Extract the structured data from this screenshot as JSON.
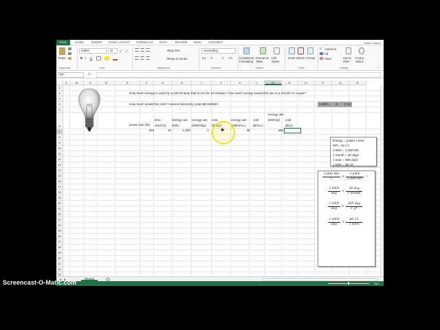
{
  "ribbon": {
    "tabs": [
      "FILE",
      "HOME",
      "INSERT",
      "PAGE LAYOUT",
      "FORMULAS",
      "DATA",
      "REVIEW",
      "VIEW",
      "ACROBAT"
    ],
    "user": "Daniel Kasper",
    "paste_label": "Paste",
    "font_name": "Calibri",
    "font_size": "11",
    "bold": "B",
    "italic": "I",
    "underline": "U",
    "wrap_text": "Wrap Text",
    "merge_center": "Merge & Center",
    "number_format": "Accounting",
    "conditional_formatting": "Conditional Formatting",
    "format_as_table": "Format as Table",
    "cell_styles": "Cell Styles",
    "insert": "Insert",
    "delete": "Delete",
    "format": "Format",
    "autosum": "AutoSum",
    "fill": "Fill",
    "clear": "Clear",
    "sort_filter": "Sort & Filter",
    "find_select": "Find & Select",
    "groups": {
      "clipboard": "Clipboard",
      "font": "Font",
      "alignment": "Alignment",
      "number": "Number",
      "styles": "Styles",
      "cells": "Cells",
      "editing": "Editing"
    }
  },
  "formula_bar": {
    "name_box": "M7",
    "fx": "fx",
    "formula": ""
  },
  "columns": [
    "A",
    "B",
    "C",
    "D",
    "E",
    "F",
    "G",
    "H",
    "I",
    "J",
    "K",
    "L",
    "M",
    "N",
    "O",
    "P",
    "Q",
    "R"
  ],
  "selected_column": "M",
  "rows": [
    "1",
    "2",
    "3",
    "4",
    "5",
    "6",
    "7",
    "8",
    "9",
    "10",
    "11",
    "12",
    "13",
    "14",
    "15",
    "16",
    "17",
    "18",
    "19",
    "20",
    "21",
    "22",
    "23",
    "24",
    "25",
    "26",
    "27",
    "28",
    "29",
    "30",
    "31",
    "32",
    "33",
    "34",
    "35",
    "36",
    "37",
    "38",
    "39"
  ],
  "selected_row": "7",
  "sheet": {
    "question1": "How much energy is used by a 100 W lamp that is run for 10 hrs/day?  How much energy would this use in a month? In a year?",
    "question2": "How much would this cost?  Assume electricity costs $0.15/kWh.",
    "kwh_label": "1 kWh =",
    "kwh_currency": "$",
    "kwh_value": "0.15",
    "headers": {
      "power_use": "power use (W)",
      "time_used": "time used (h)",
      "energy_use_wh": "energy use (Wh)",
      "energy_use_kwh_day": "energy use (kWh/day)",
      "cost_day": "cost ($/day)",
      "energy_use_kwh_mo": "energy use (kWh/mo.)",
      "cost_mo": "cost ($/mo.)",
      "energy_use_kwh_yr": "energy use (kWh/yr)",
      "cost_yr": "cost ($/yr)"
    },
    "values": {
      "power_use": "100",
      "time_used": "10",
      "energy_use_wh": "1,000",
      "energy_use_kwh_day": "1",
      "energy_use_kwh_mo": "30",
      "energy_use_kwh_yr": "365"
    }
  },
  "note": {
    "lines": [
      "Energy = power x time",
      "Wh = W x h",
      "1 kWh = 1,000 Wh",
      "1 month = 30 days",
      "1 year = 365 days",
      "1 kWh = $0.15"
    ]
  },
  "conversions": {
    "f1": {
      "n1": "1,000 Wh",
      "d1": "1",
      "n2": "1 kWh",
      "d2": "1,000 Wh",
      "eq": "="
    },
    "f2": {
      "n1": "1 kWh",
      "d1": "day",
      "n2": "30 day",
      "d2": "1 month"
    },
    "f3": {
      "n1": "1 kWh",
      "d1": "day",
      "n2": "365 day",
      "d2": "1 yr"
    },
    "f4": {
      "n1": "1 kWh",
      "d1": "day",
      "n2": "$0.15",
      "d2": "1 kWh"
    },
    "times": "×"
  },
  "sheet_tabs": {
    "active": "Sheet1",
    "add": "+"
  },
  "status": {
    "zoom": "100"
  },
  "watermark": "Screencast-O-Matic.com",
  "colors": {
    "accent": "#217346",
    "kwh_cell_bg": "#a6a6a6"
  }
}
